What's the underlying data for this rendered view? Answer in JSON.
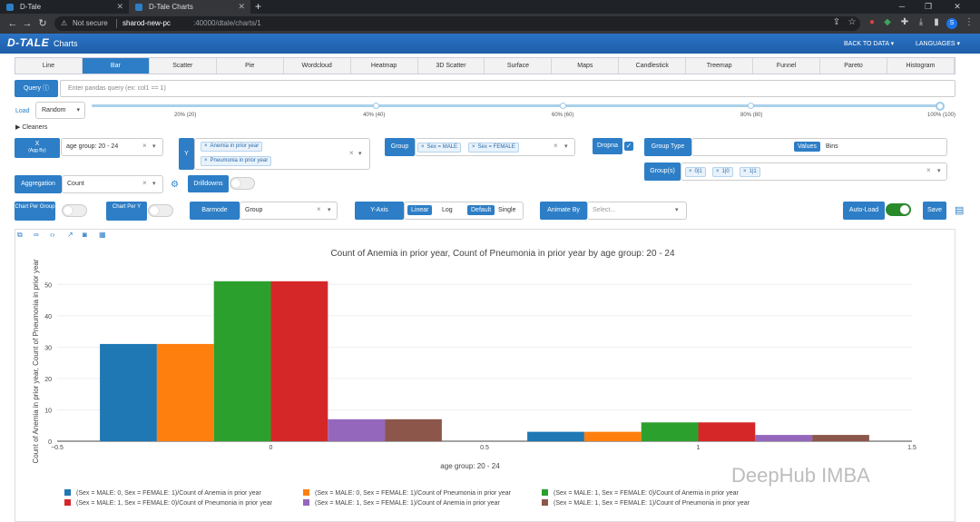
{
  "browser": {
    "tabs": [
      {
        "title": "D-Tale",
        "active": false
      },
      {
        "title": "D-Tale Charts",
        "active": true
      }
    ],
    "new_tab": "+",
    "security": "Not secure",
    "url_host": "sharod-new-pc",
    "url_path": ":40000/dtale/charts/1",
    "profile_initial": "S"
  },
  "header": {
    "logo": "D-TALE",
    "title": "Charts",
    "back_to_data": "BACK TO DATA ▾",
    "languages": "LANGUAGES ▾"
  },
  "chart_types": [
    "Line",
    "Bar",
    "Scatter",
    "Pie",
    "Wordcloud",
    "Heatmap",
    "3D Scatter",
    "Surface",
    "Maps",
    "Candlestick",
    "Treemap",
    "Funnel",
    "Pareto",
    "Histogram"
  ],
  "active_chart_type": "Bar",
  "query": {
    "label": "Query",
    "placeholder": "Enter pandas query (ex: col1 == 1)"
  },
  "load": {
    "label": "Load",
    "value": "Random",
    "ticks": [
      "20% (20)",
      "40% (40)",
      "60% (60)",
      "80% (80)",
      "100% (100)"
    ],
    "selected_percent": 100
  },
  "cleaners_label": "▶ Cleaners",
  "x": {
    "label": "X",
    "sublabel": "(Agg By)",
    "value": "age group:  20 -  24"
  },
  "y": {
    "label": "Y",
    "values": [
      "Anemia in prior year",
      "Pneumonia in prior year"
    ]
  },
  "group": {
    "label": "Group",
    "values": [
      "Sex = MALE",
      "Sex = FEMALE"
    ]
  },
  "dropna": {
    "label": "Dropna",
    "checked": true
  },
  "group_type": {
    "label": "Group Type",
    "options": [
      "Values",
      "Bins"
    ],
    "selected": "Values"
  },
  "groups": {
    "label": "Group(s)",
    "values": [
      "0|1",
      "1|0",
      "1|1"
    ]
  },
  "aggregation": {
    "label": "Aggregation",
    "value": "Count"
  },
  "drilldowns": {
    "label": "Drilldowns",
    "on": false
  },
  "chart_per_group": {
    "label": "Chart Per Group",
    "on": false
  },
  "chart_per_y": {
    "label": "Chart Per Y",
    "on": false
  },
  "barmode": {
    "label": "Barmode",
    "value": "Group"
  },
  "y_axis": {
    "label": "Y-Axis",
    "scale_options": [
      "Linear",
      "Log"
    ],
    "scale_selected": "Linear",
    "mode_options": [
      "Default",
      "Single"
    ],
    "mode_selected": "Default"
  },
  "animate_by": {
    "label": "Animate By",
    "placeholder": "Select..."
  },
  "auto_load": {
    "label": "Auto-Load",
    "on": true
  },
  "save_label": "Save",
  "toolbar_icons": [
    "copy-icon",
    "link-icon",
    "code-icon",
    "export-icon",
    "camera-icon",
    "export-file-icon"
  ],
  "chart_data": {
    "type": "bar",
    "title": "Count of Anemia in prior year, Count of Pneumonia in prior year by age group:  20 -  24",
    "xlabel": "age group:  20 -  24",
    "ylabel": "Count of Anemia in prior year, Count of Pneumonia in prior year",
    "xlim": [
      -0.5,
      1.5
    ],
    "ylim": [
      0,
      55
    ],
    "x_ticks": [
      -0.5,
      0,
      0.5,
      1,
      1.5
    ],
    "x_tick_labels": [
      "−0.5",
      "0",
      "0.5",
      "1",
      "1.5"
    ],
    "y_ticks": [
      0,
      10,
      20,
      30,
      40,
      50
    ],
    "grid": true,
    "legend_position": "bottom",
    "categories": [
      0,
      1
    ],
    "series": [
      {
        "name": "(Sex = MALE: 0, Sex = FEMALE: 1)/Count of Anemia in prior year",
        "color": "#1f77b4",
        "values": [
          31,
          3
        ]
      },
      {
        "name": "(Sex = MALE: 0, Sex = FEMALE: 1)/Count of Pneumonia in prior year",
        "color": "#ff7f0e",
        "values": [
          31,
          3
        ]
      },
      {
        "name": "(Sex = MALE: 1, Sex = FEMALE: 0)/Count of Anemia in prior year",
        "color": "#2ca02c",
        "values": [
          51,
          6
        ]
      },
      {
        "name": "(Sex = MALE: 1, Sex = FEMALE: 0)/Count of Pneumonia in prior year",
        "color": "#d62728",
        "values": [
          51,
          6
        ]
      },
      {
        "name": "(Sex = MALE: 1, Sex = FEMALE: 1)/Count of Anemia in prior year",
        "color": "#9467bd",
        "values": [
          7,
          2
        ]
      },
      {
        "name": "(Sex = MALE: 1, Sex = FEMALE: 1)/Count of Pneumonia in prior year",
        "color": "#8c564b",
        "values": [
          7,
          2
        ]
      }
    ]
  },
  "watermark": "DeepHub IMBA"
}
